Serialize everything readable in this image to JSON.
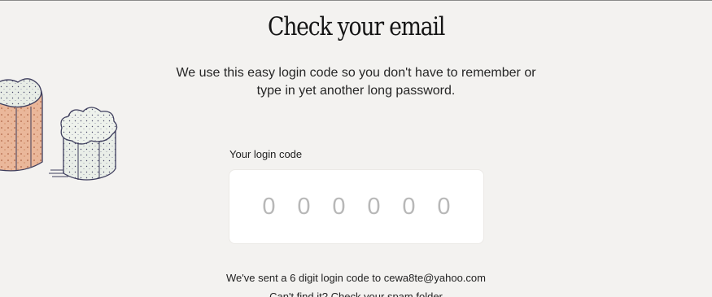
{
  "heading": "Check your email",
  "description_line1": "We use this easy login code so you don't have to remember or",
  "description_line2": "type in yet another long password.",
  "code_field": {
    "label": "Your login code",
    "digits": [
      "0",
      "0",
      "0",
      "0",
      "0",
      "0"
    ]
  },
  "footer": {
    "sent_message": "We've sent a 6 digit login code to cewa8te@yahoo.com",
    "spam_message": "Can't find it? Check your spam folder"
  },
  "colors": {
    "background": "#f3f2f0",
    "input_background": "#ffffff",
    "placeholder_digits": "#b8b8b8"
  },
  "icons": [
    "marshmallow-illustration"
  ]
}
